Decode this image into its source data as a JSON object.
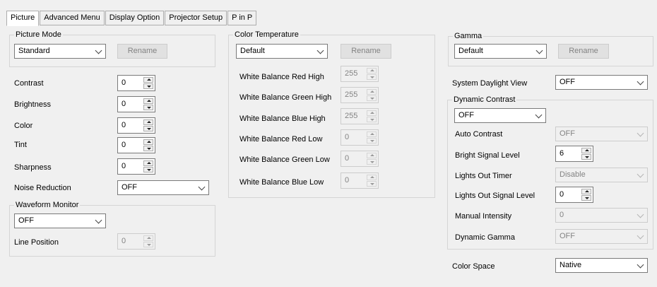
{
  "tabs": [
    "Picture",
    "Advanced Menu",
    "Display Option",
    "Projector Setup",
    "P in P"
  ],
  "picture_mode": {
    "title": "Picture Mode",
    "value": "Standard",
    "rename": "Rename"
  },
  "adjust": {
    "contrast": {
      "label": "Contrast",
      "value": "0"
    },
    "brightness": {
      "label": "Brightness",
      "value": "0"
    },
    "color": {
      "label": "Color",
      "value": "0"
    },
    "tint": {
      "label": "Tint",
      "value": "0"
    },
    "sharpness": {
      "label": "Sharpness",
      "value": "0"
    },
    "noise_reduction": {
      "label": "Noise Reduction",
      "value": "OFF"
    }
  },
  "waveform": {
    "title": "Waveform Monitor",
    "value": "OFF",
    "line_position_label": "Line Position",
    "line_position_value": "0"
  },
  "color_temp": {
    "title": "Color Temperature",
    "value": "Default",
    "rename": "Rename",
    "red_high": {
      "label": "White Balance Red High",
      "value": "255"
    },
    "green_high": {
      "label": "White Balance Green High",
      "value": "255"
    },
    "blue_high": {
      "label": "White Balance Blue High",
      "value": "255"
    },
    "red_low": {
      "label": "White Balance Red Low",
      "value": "0"
    },
    "green_low": {
      "label": "White Balance Green Low",
      "value": "0"
    },
    "blue_low": {
      "label": "White Balance Blue Low",
      "value": "0"
    }
  },
  "gamma": {
    "title": "Gamma",
    "value": "Default",
    "rename": "Rename"
  },
  "daylight": {
    "label": "System Daylight View",
    "value": "OFF"
  },
  "dynamic_contrast": {
    "title": "Dynamic Contrast",
    "value": "OFF",
    "auto_contrast": {
      "label": "Auto Contrast",
      "value": "OFF"
    },
    "bright_signal": {
      "label": "Bright Signal Level",
      "value": "6"
    },
    "lights_out_timer": {
      "label": "Lights Out Timer",
      "value": "Disable"
    },
    "lights_out_signal": {
      "label": "Lights Out Signal Level",
      "value": "0"
    },
    "manual_intensity": {
      "label": "Manual Intensity",
      "value": "0"
    },
    "dynamic_gamma": {
      "label": "Dynamic Gamma",
      "value": "OFF"
    }
  },
  "color_space": {
    "label": "Color Space",
    "value": "Native"
  }
}
